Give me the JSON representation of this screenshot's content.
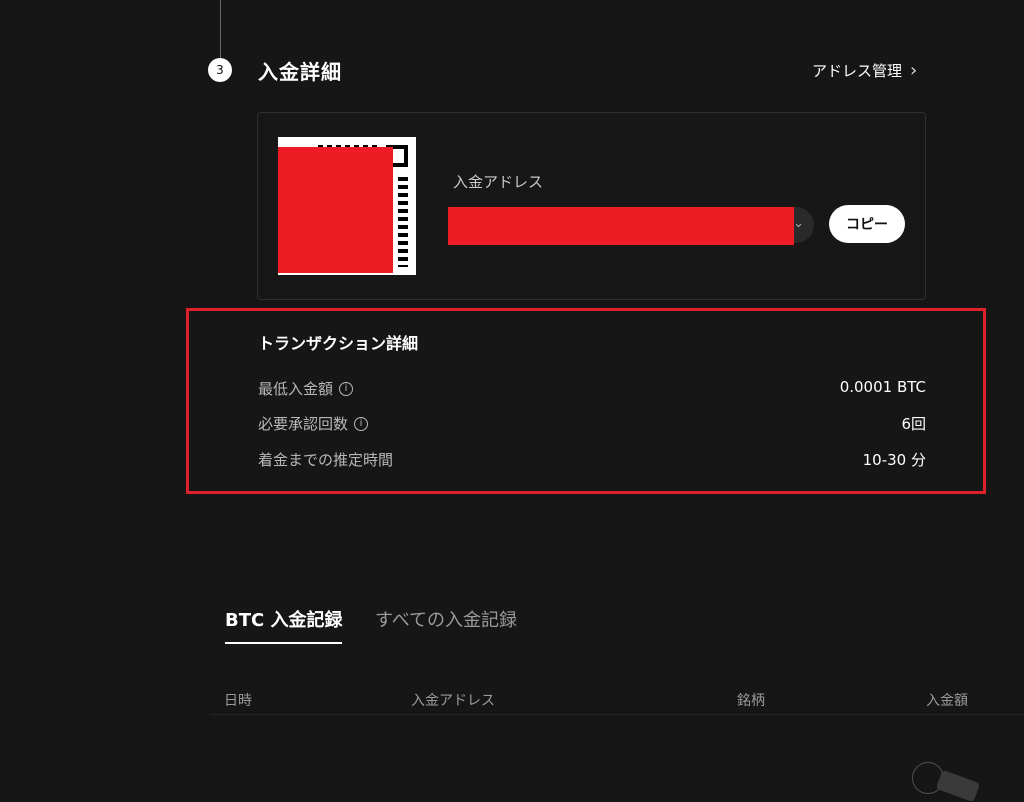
{
  "step": {
    "number": "3",
    "title": "入金詳細",
    "address_management": "アドレス管理"
  },
  "deposit": {
    "address_label": "入金アドレス",
    "copy_label": "コピー"
  },
  "transaction": {
    "title": "トランザクション詳細",
    "rows": [
      {
        "label": "最低入金額",
        "value": "0.0001 BTC",
        "info": true
      },
      {
        "label": "必要承認回数",
        "value": "6回",
        "info": true
      },
      {
        "label": "着金までの推定時間",
        "value": "10-30 分",
        "info": false
      }
    ]
  },
  "tabs": [
    {
      "label": "BTC 入金記録",
      "active": true
    },
    {
      "label": "すべての入金記録",
      "active": false
    }
  ],
  "table": {
    "columns": [
      "日時",
      "入金アドレス",
      "銘柄",
      "入金額"
    ]
  },
  "colors": {
    "background": "#161616",
    "highlight_border": "#e0202a",
    "redaction": "#ee1c25"
  },
  "icons": {
    "info": "info-icon",
    "chevron": "chevron-right-icon",
    "qr": "qr-code-icon"
  }
}
